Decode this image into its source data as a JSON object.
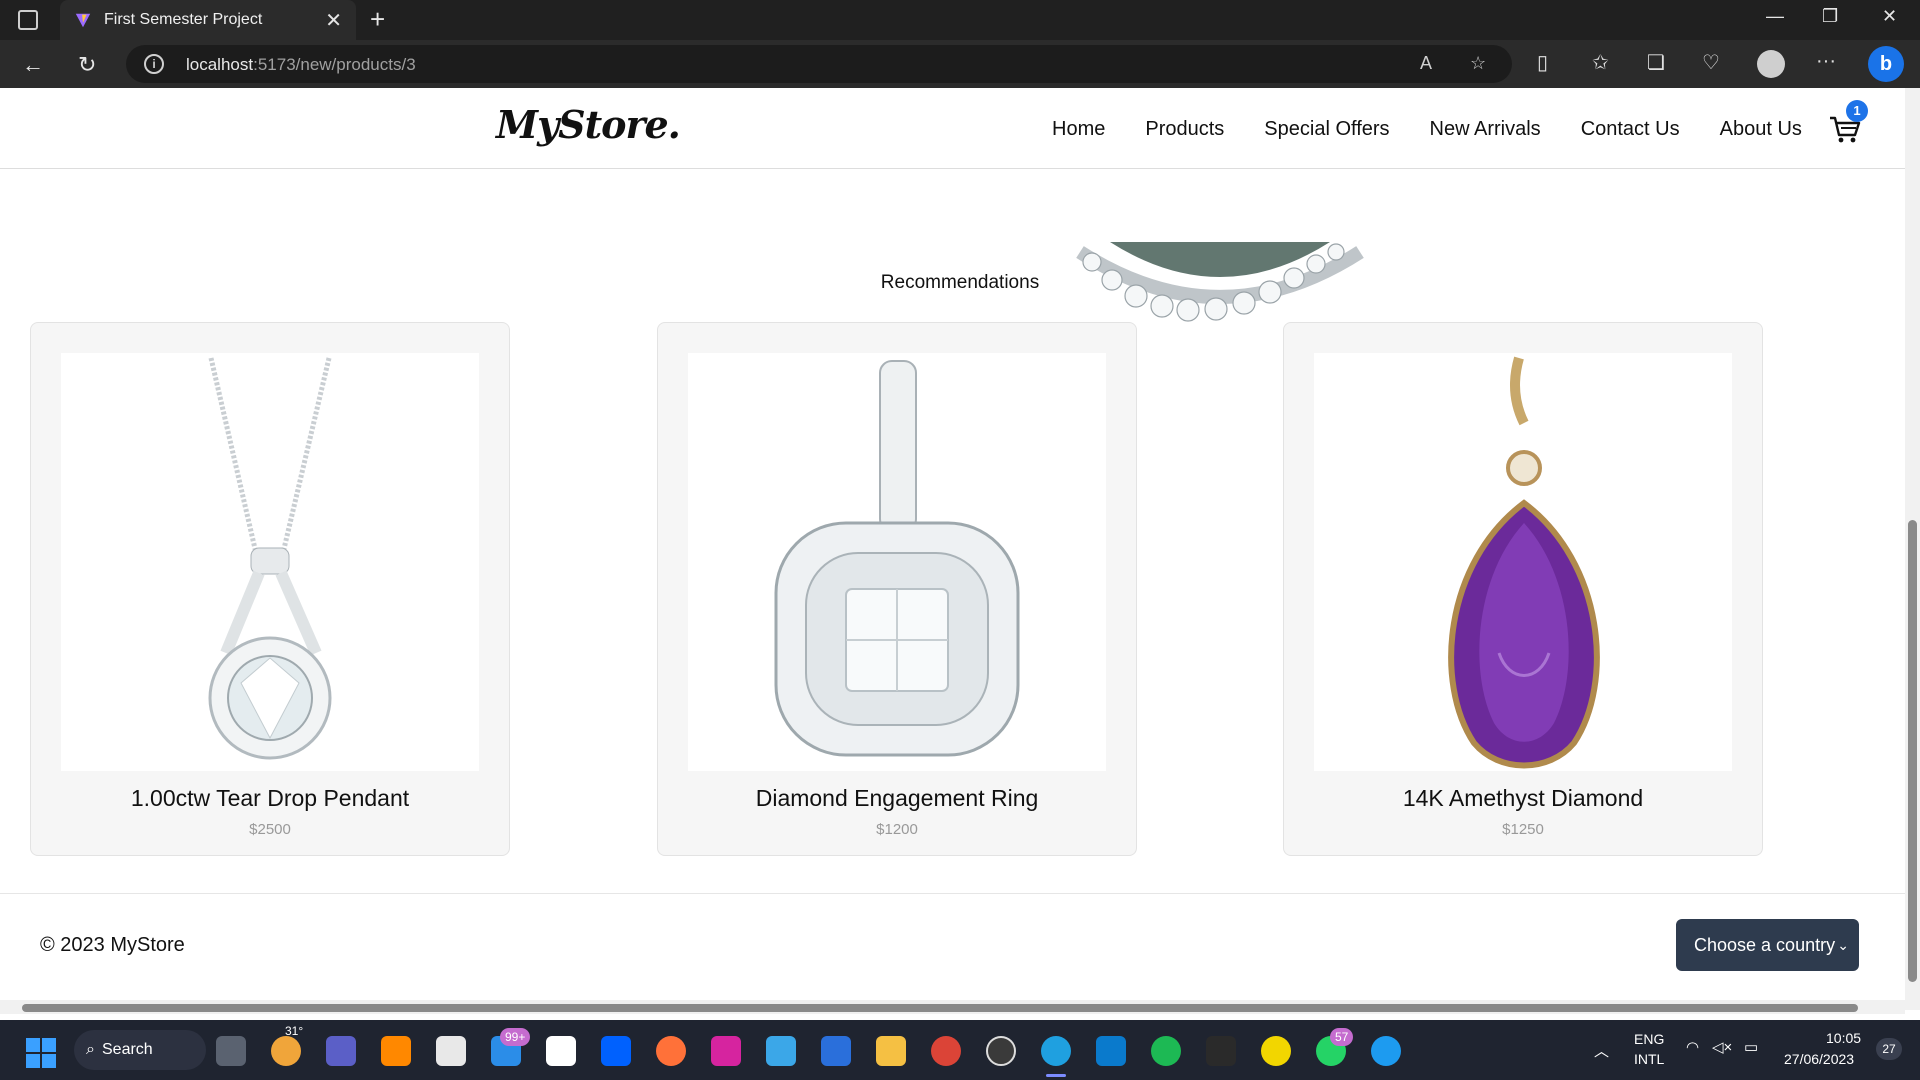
{
  "browser": {
    "tab_title": "First Semester Project",
    "url_host": "localhost",
    "url_path": ":5173/new/products/3"
  },
  "site": {
    "logo": "MyStore.",
    "nav": [
      "Home",
      "Products",
      "Special Offers",
      "New Arrivals",
      "Contact Us",
      "About Us"
    ],
    "cart_count": "1"
  },
  "recommendations": {
    "title": "Recommendations",
    "items": [
      {
        "name": "1.00ctw Tear Drop Pendant",
        "price": "$2500"
      },
      {
        "name": "Diamond Engagement Ring",
        "price": "$1200"
      },
      {
        "name": "14K Amethyst Diamond",
        "price": "$1250"
      }
    ]
  },
  "footer": {
    "copyright": "© 2023 MyStore",
    "country_select": "Choose a country"
  },
  "taskbar": {
    "search": "Search",
    "weather": "31°",
    "mail_badge": "99+",
    "whatsapp_badge": "57",
    "lang1": "ENG",
    "lang2": "INTL",
    "time": "10:05",
    "date": "27/06/2023",
    "notifications": "27"
  },
  "colors": {
    "accent": "#1e73e8",
    "country_button": "#2e3b4e",
    "amethyst": "#6b2a9a"
  }
}
